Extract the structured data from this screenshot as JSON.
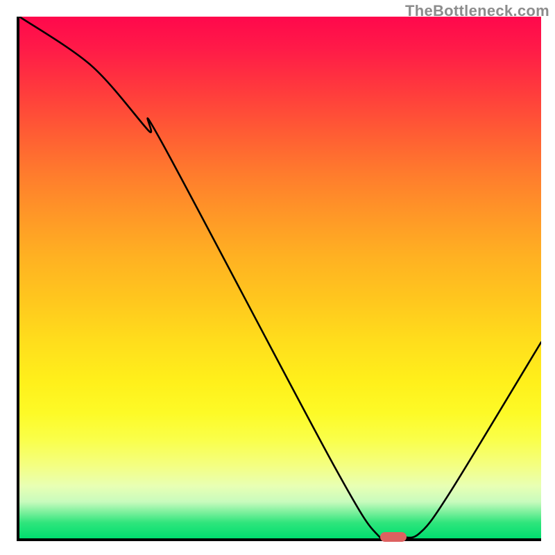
{
  "watermark": "TheBottleneck.com",
  "chart_data": {
    "type": "line",
    "title": "",
    "xlabel": "",
    "ylabel": "",
    "xlim": [
      0,
      100
    ],
    "ylim": [
      0,
      100
    ],
    "x": [
      0,
      13.8,
      24.7,
      27.3,
      60.2,
      69.0,
      73.0,
      76.6,
      82.4,
      100
    ],
    "y": [
      100,
      90.6,
      78.2,
      75.9,
      14.1,
      0.3,
      0.3,
      0.9,
      8.6,
      37.6
    ],
    "marker": {
      "x": 71.7,
      "y": 0.3
    }
  },
  "colors": {
    "line": "#000000",
    "marker": "#dd6160",
    "axis": "#000000"
  }
}
